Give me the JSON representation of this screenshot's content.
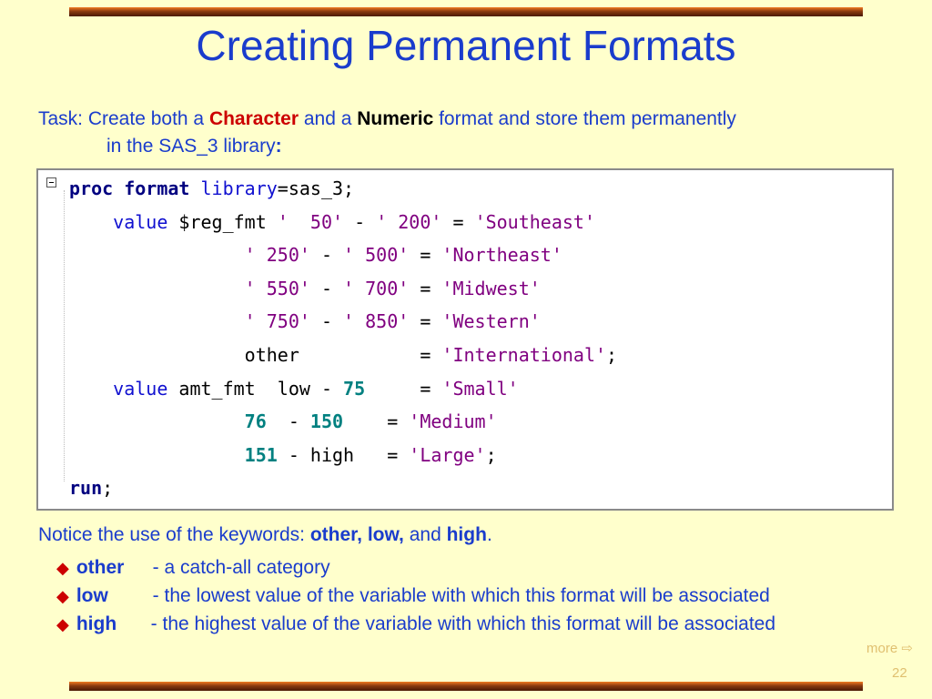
{
  "slide": {
    "title": "Creating Permanent Formats",
    "task": {
      "prefix": "Task: Create both a ",
      "character": "Character",
      "mid": "  and a ",
      "numeric": "Numeric",
      "suffix": "  format and store them permanently",
      "line2": "in the SAS_3 library",
      "line2_colon": ":"
    },
    "code_lines": [
      [
        {
          "t": "proc format",
          "c": "kw"
        },
        {
          "t": " ",
          "c": "plain"
        },
        {
          "t": "library",
          "c": "opt"
        },
        {
          "t": "=sas_3;",
          "c": "plain"
        }
      ],
      [
        {
          "t": "    ",
          "c": "plain"
        },
        {
          "t": "value",
          "c": "opt"
        },
        {
          "t": " $reg_fmt ",
          "c": "plain"
        },
        {
          "t": "'  50'",
          "c": "str"
        },
        {
          "t": " - ",
          "c": "plain"
        },
        {
          "t": "' 200'",
          "c": "str"
        },
        {
          "t": " = ",
          "c": "plain"
        },
        {
          "t": "'Southeast'",
          "c": "str"
        }
      ],
      [
        {
          "t": "                ",
          "c": "plain"
        },
        {
          "t": "' 250'",
          "c": "str"
        },
        {
          "t": " - ",
          "c": "plain"
        },
        {
          "t": "' 500'",
          "c": "str"
        },
        {
          "t": " = ",
          "c": "plain"
        },
        {
          "t": "'Northeast'",
          "c": "str"
        }
      ],
      [
        {
          "t": "                ",
          "c": "plain"
        },
        {
          "t": "' 550'",
          "c": "str"
        },
        {
          "t": " - ",
          "c": "plain"
        },
        {
          "t": "' 700'",
          "c": "str"
        },
        {
          "t": " = ",
          "c": "plain"
        },
        {
          "t": "'Midwest'",
          "c": "str"
        }
      ],
      [
        {
          "t": "                ",
          "c": "plain"
        },
        {
          "t": "' 750'",
          "c": "str"
        },
        {
          "t": " - ",
          "c": "plain"
        },
        {
          "t": "' 850'",
          "c": "str"
        },
        {
          "t": " = ",
          "c": "plain"
        },
        {
          "t": "'Western'",
          "c": "str"
        }
      ],
      [
        {
          "t": "                other           = ",
          "c": "plain"
        },
        {
          "t": "'International'",
          "c": "str"
        },
        {
          "t": ";",
          "c": "plain"
        }
      ],
      [
        {
          "t": "    ",
          "c": "plain"
        },
        {
          "t": "value",
          "c": "opt"
        },
        {
          "t": " amt_fmt  low - ",
          "c": "plain"
        },
        {
          "t": "75",
          "c": "num"
        },
        {
          "t": "     = ",
          "c": "plain"
        },
        {
          "t": "'Small'",
          "c": "str"
        }
      ],
      [
        {
          "t": "                ",
          "c": "plain"
        },
        {
          "t": "76",
          "c": "num"
        },
        {
          "t": "  - ",
          "c": "plain"
        },
        {
          "t": "150",
          "c": "num"
        },
        {
          "t": "    = ",
          "c": "plain"
        },
        {
          "t": "'Medium'",
          "c": "str"
        }
      ],
      [
        {
          "t": "                ",
          "c": "plain"
        },
        {
          "t": "151",
          "c": "num"
        },
        {
          "t": " - high   = ",
          "c": "plain"
        },
        {
          "t": "'Large'",
          "c": "str"
        },
        {
          "t": ";",
          "c": "plain"
        }
      ],
      [
        {
          "t": "run",
          "c": "kw"
        },
        {
          "t": ";",
          "c": "plain"
        }
      ]
    ],
    "notice": {
      "prefix": "Notice the use of the keywords:  ",
      "keywords": "other, low,",
      "and": " and ",
      "high": "high",
      "period": "."
    },
    "bullets": [
      {
        "term": "other",
        "desc": " - a catch-all category"
      },
      {
        "term": "low",
        "desc": " - the lowest value of the variable with which this format will be associated"
      },
      {
        "term": "high",
        "desc": " - the highest value of the variable with which this format will be associated"
      }
    ],
    "bullet_glyph": "◆",
    "more_label": "more ⇨",
    "page_number": "22"
  },
  "colors": {
    "background": "#ffffcc",
    "title": "#1a3ccc",
    "character_keyword": "#cc0000",
    "code_keyword": "#000080",
    "code_string": "#800080",
    "code_number": "#008080"
  }
}
